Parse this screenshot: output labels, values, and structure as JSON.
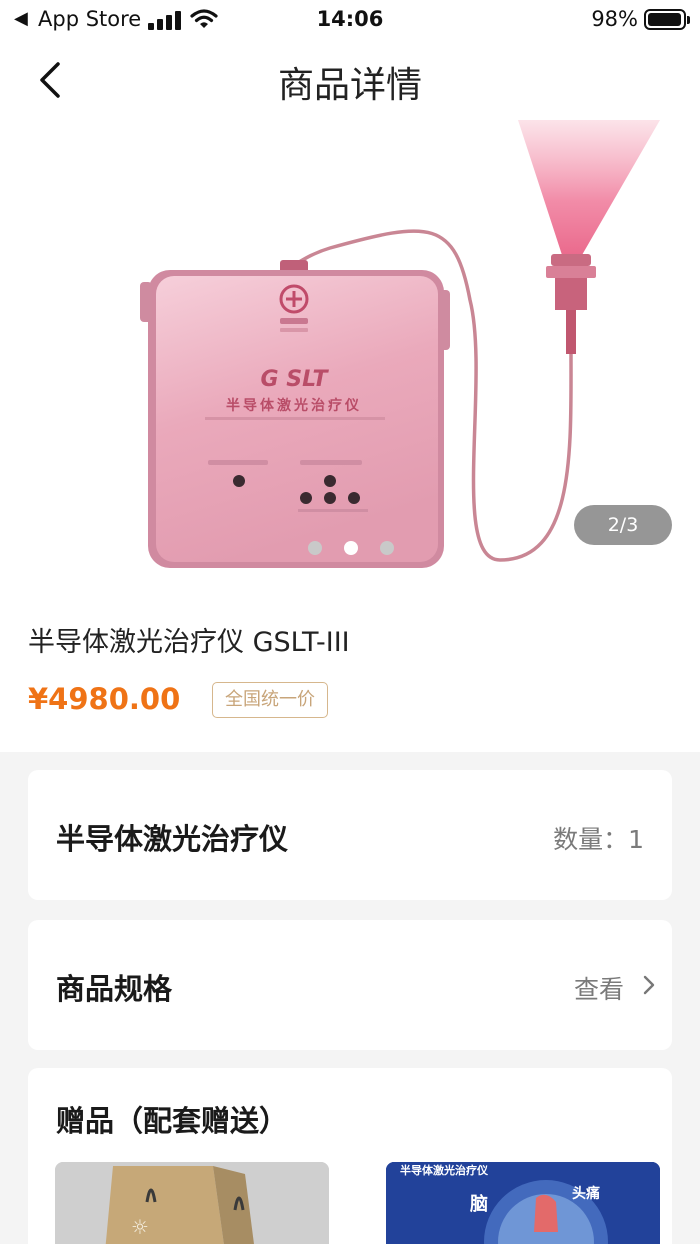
{
  "status_bar": {
    "back_glyph": "◀",
    "carrier": "App Store",
    "time": "14:06",
    "battery": "98%",
    "battery_level": 0.98
  },
  "nav": {
    "title": "商品详情",
    "back_icon": "chevron-left-icon"
  },
  "gallery": {
    "counter": "2/3",
    "dot_count": 3,
    "active_index": 1,
    "device_brand": "G SLT",
    "device_caption": "半导体激光治疗仪"
  },
  "product": {
    "name": "半导体激光治疗仪 GSLT-III",
    "price": "¥4980.00",
    "price_tag": "全国统一价"
  },
  "item_card": {
    "title": "半导体激光治疗仪",
    "quantity_text": "数量：1"
  },
  "spec_card": {
    "title": "商品规格",
    "action": "查看",
    "arrow_icon": "chevron-right-icon"
  },
  "gifts_card": {
    "title": "赠品（配套赠送）",
    "gift2_caption": "半导体激光治疗仪",
    "gift2_text_a": "脑",
    "gift2_text_b": "头痛"
  },
  "colors": {
    "accent_price": "#ef7316",
    "tag_border": "#d6b78d",
    "device_pink": "#e8a7ba"
  }
}
